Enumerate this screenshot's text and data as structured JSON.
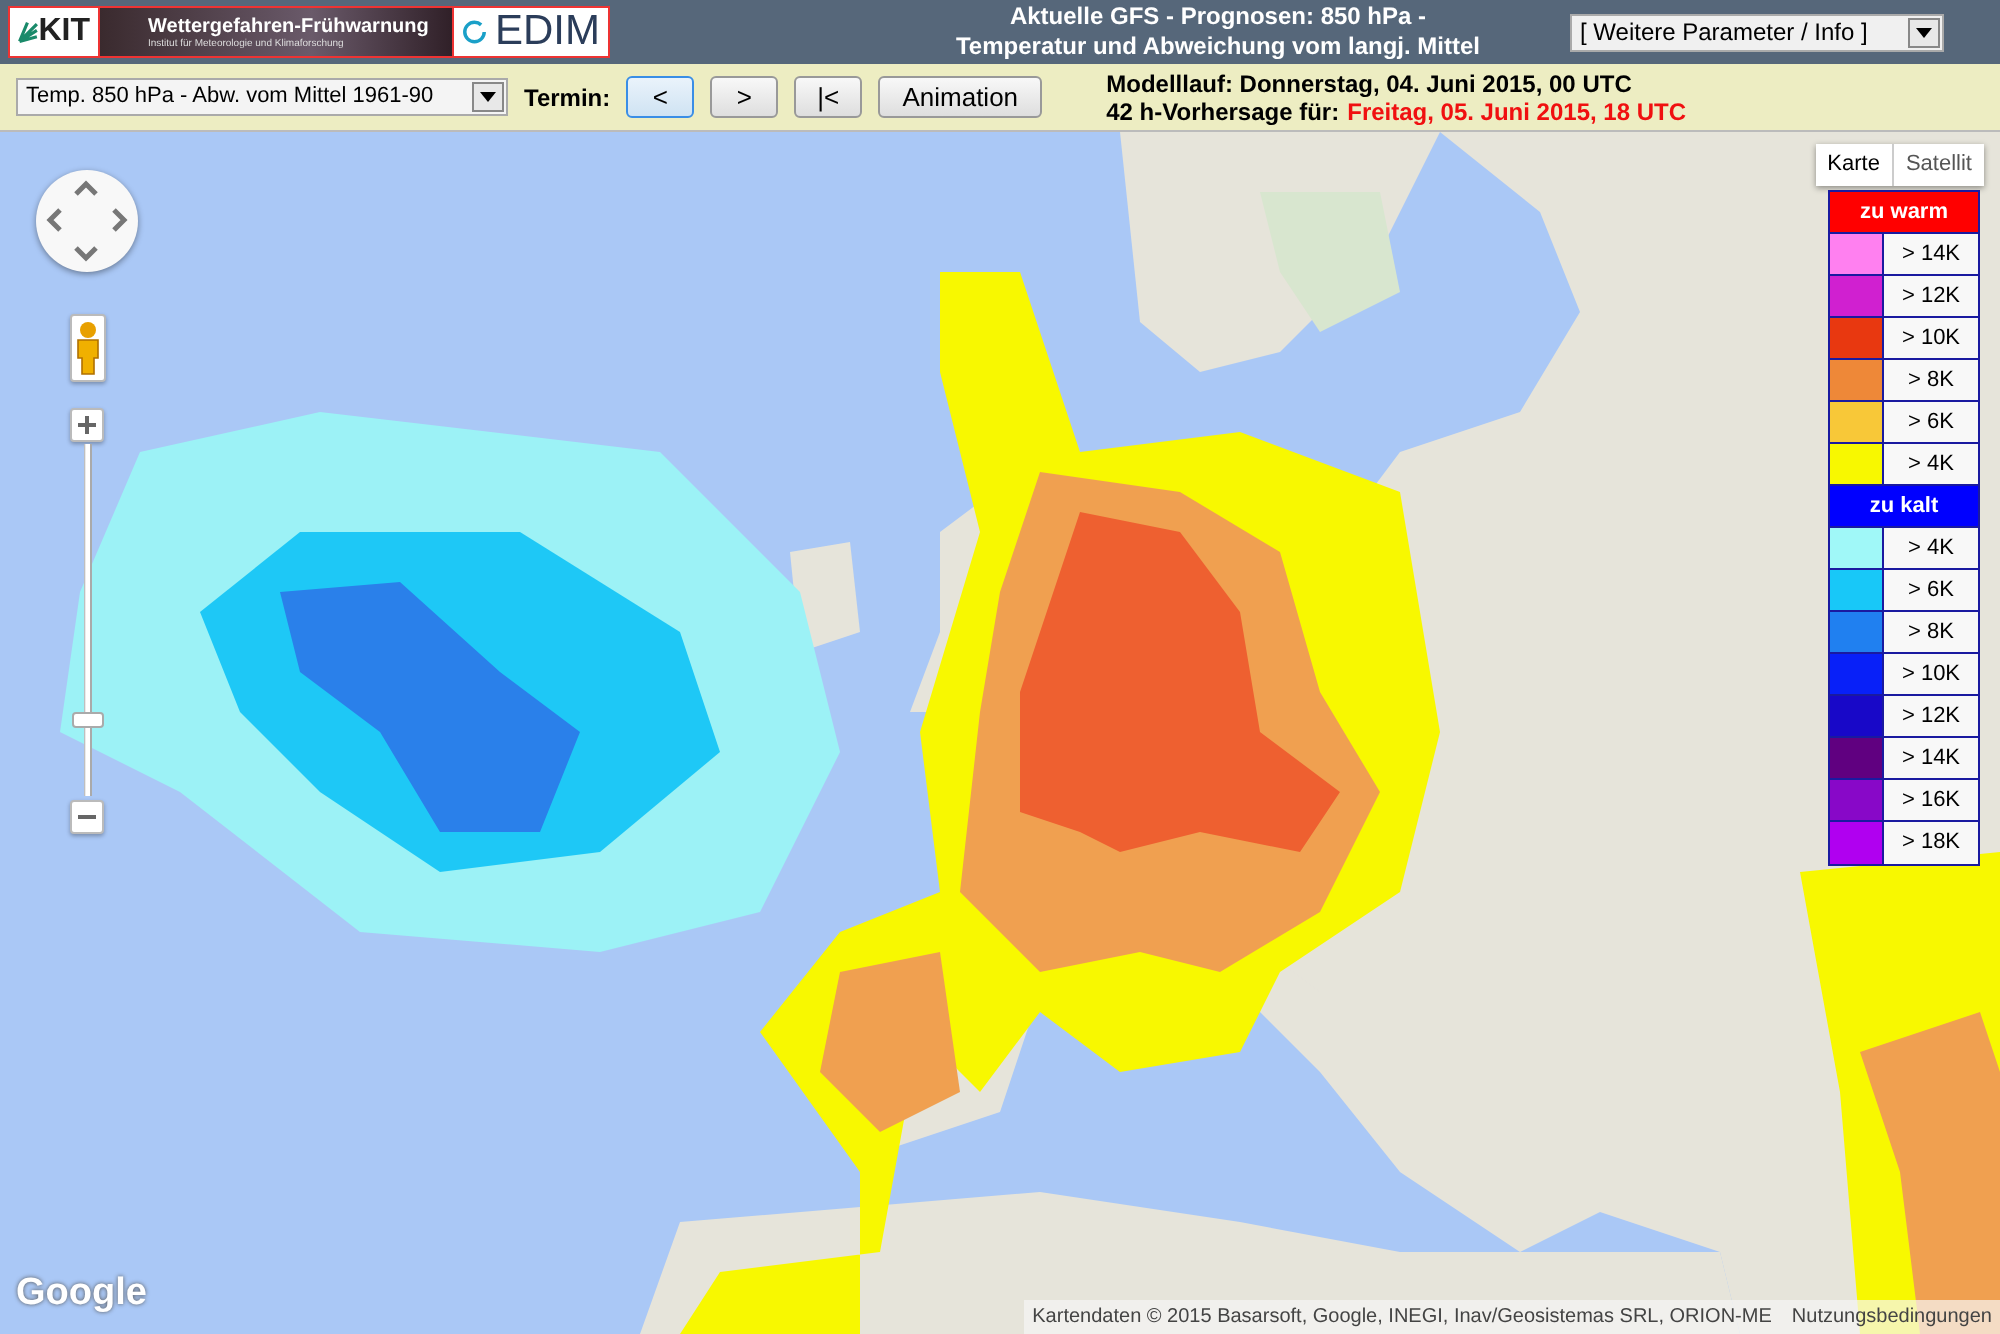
{
  "header": {
    "logos": {
      "kit": "KIT",
      "banner_title": "Wettergefahren-Frühwarnung",
      "banner_subtitle": "Institut für Meteorologie und Klimaforschung",
      "cedim": "EDIM"
    },
    "title_lines": [
      "Aktuelle GFS - Prognosen: 850 hPa -",
      "Temperatur und Abweichung vom langj. Mittel"
    ],
    "info_select": {
      "value": "[ Weitere Parameter / Info ]"
    }
  },
  "toolbar": {
    "parameter_select": {
      "value": "Temp. 850 hPa - Abw. vom Mittel 1961-90"
    },
    "termin_label": "Termin:",
    "buttons": [
      {
        "label": "<",
        "focused": true
      },
      {
        "label": ">",
        "focused": false
      },
      {
        "label": "|<",
        "focused": false
      },
      {
        "label": "Animation",
        "focused": false
      }
    ],
    "model_run": "Modelllauf: Donnerstag, 04. Juni 2015, 00 UTC",
    "forecast_label": "42 h-Vorhersage für:",
    "forecast_time": "Freitag, 05. Juni 2015, 18 UTC"
  },
  "map": {
    "map_types": [
      {
        "label": "Karte",
        "selected": true
      },
      {
        "label": "Satellit",
        "selected": false
      }
    ],
    "zoom_slider": {
      "level": 0.2
    },
    "legend": [
      {
        "title": "zu warm",
        "color": "#ff0000",
        "items": [
          {
            "label": "> 14K",
            "color": "#ff80f0"
          },
          {
            "label": "> 12K",
            "color": "#d020d0"
          },
          {
            "label": "> 10K",
            "color": "#e83810"
          },
          {
            "label": "> 8K",
            "color": "#ee8838"
          },
          {
            "label": "> 6K",
            "color": "#f8c838"
          },
          {
            "label": "> 4K",
            "color": "#f8f800"
          }
        ]
      },
      {
        "title": "zu kalt",
        "color": "#0000ff",
        "items": [
          {
            "label": "> 4K",
            "color": "#a0f8f8"
          },
          {
            "label": "> 6K",
            "color": "#18c8f8"
          },
          {
            "label": "> 8K",
            "color": "#2080f0"
          },
          {
            "label": "> 10K",
            "color": "#0820f8"
          },
          {
            "label": "> 12K",
            "color": "#1808c8"
          },
          {
            "label": "> 14K",
            "color": "#600080"
          },
          {
            "label": "> 16K",
            "color": "#8808c8"
          },
          {
            "label": "> 18K",
            "color": "#b000f0"
          }
        ]
      }
    ],
    "google_logo": "Google",
    "attribution": "Kartendaten © 2015 Basarsoft, Google, INEGI, Inav/Geosistemas SRL, ORION-ME",
    "terms_link": "Nutzungsbedingungen"
  }
}
